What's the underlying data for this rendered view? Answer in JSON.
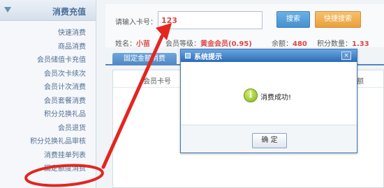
{
  "sidebar": {
    "title": "消费充值",
    "items": [
      {
        "label": "快速消费"
      },
      {
        "label": "商品消费"
      },
      {
        "label": "会员储值卡充值"
      },
      {
        "label": "会员次卡续次"
      },
      {
        "label": "会员计次消费"
      },
      {
        "label": "会员套餐消费"
      },
      {
        "label": "积分兑换礼品"
      },
      {
        "label": "会员退货"
      },
      {
        "label": "积分兑换礼品审核"
      },
      {
        "label": "消费挂单列表"
      },
      {
        "label": "固定额度消费"
      }
    ]
  },
  "search": {
    "label": "请输入卡号：",
    "value": "123",
    "search_btn": "搜索",
    "quick_btn": "快捷搜索"
  },
  "member": {
    "name_label": "姓名：",
    "name": "小苗",
    "level_label": "会员等级：",
    "level": "黄金会员(0.95)",
    "balance_label": "余额：",
    "balance": "480",
    "points_label": "积分数量：",
    "points": "1.33"
  },
  "tab": {
    "label": "固定金额消费"
  },
  "table": {
    "headers": [
      "会员卡号",
      "额"
    ]
  },
  "dialog": {
    "title": "系统提示",
    "close": "×",
    "message": "消费成功!",
    "icon": "i",
    "ok": "确 定"
  },
  "annotation": {
    "color": "#e3261f"
  }
}
